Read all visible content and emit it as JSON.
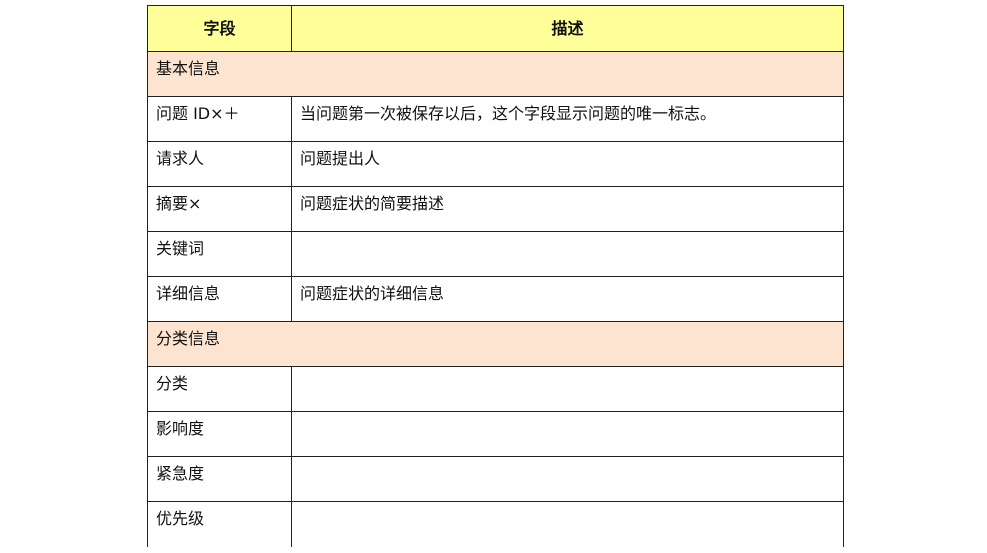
{
  "colors": {
    "header_bg": "#ffff99",
    "section_bg": "#fde4d0",
    "row_bg": "#ffffff",
    "border": "#222222"
  },
  "header": {
    "field": "字段",
    "description": "描述"
  },
  "sections": [
    {
      "title": "基本信息",
      "rows": [
        {
          "field": "问题 ID×＋",
          "description": "当问题第一次被保存以后，这个字段显示问题的唯一标志。"
        },
        {
          "field": "请求人",
          "description": "问题提出人"
        },
        {
          "field": "摘要×",
          "description": "问题症状的简要描述"
        },
        {
          "field": "关键词",
          "description": ""
        },
        {
          "field": "详细信息",
          "description": "问题症状的详细信息"
        }
      ]
    },
    {
      "title": "分类信息",
      "rows": [
        {
          "field": "分类",
          "description": ""
        },
        {
          "field": "影响度",
          "description": ""
        },
        {
          "field": "紧急度",
          "description": ""
        },
        {
          "field": "优先级",
          "description": ""
        }
      ]
    }
  ]
}
